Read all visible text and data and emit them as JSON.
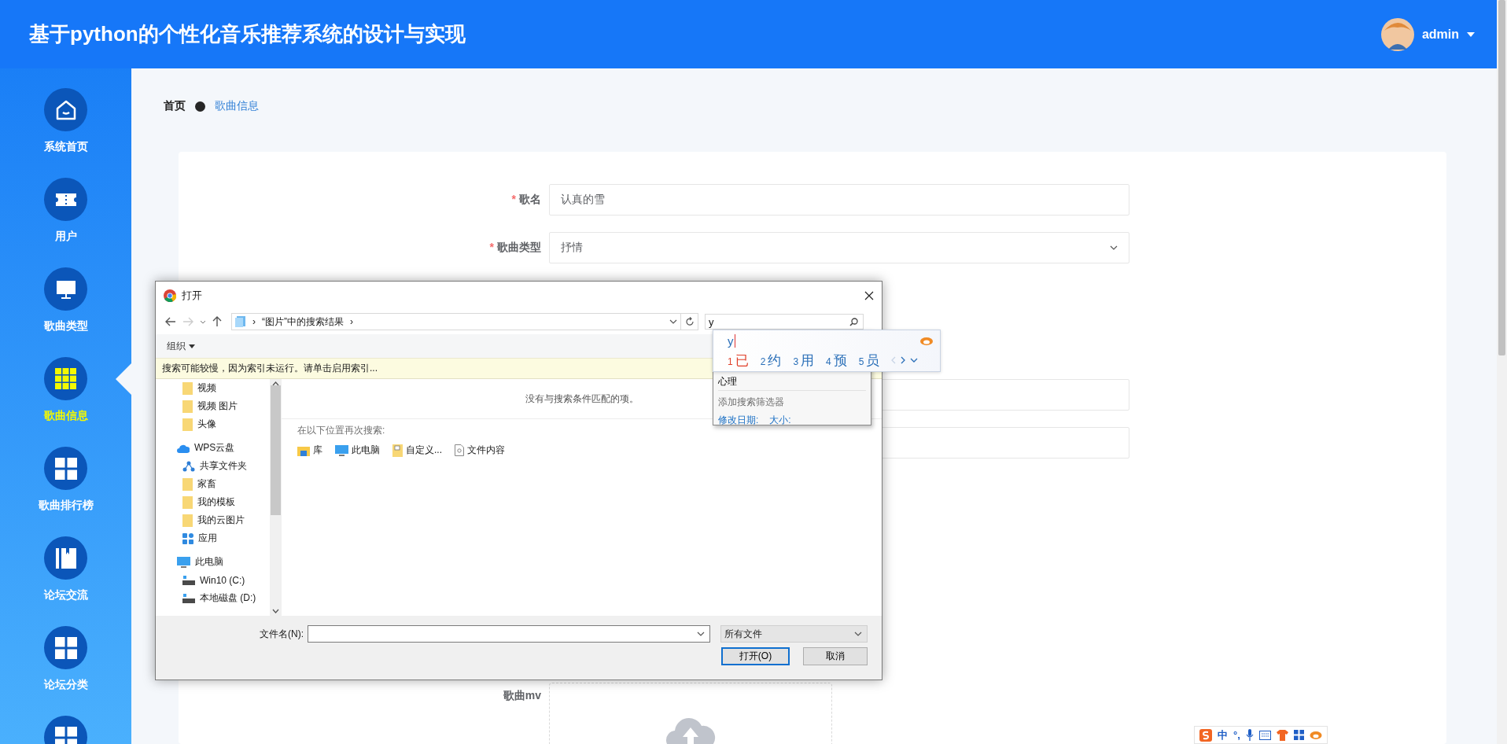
{
  "header": {
    "title": "基于python的个性化音乐推荐系统的设计与实现",
    "user": {
      "name": "admin"
    }
  },
  "sidebar": {
    "items": [
      {
        "label": "系统首页",
        "kind": "home",
        "selected": false
      },
      {
        "label": "用户",
        "kind": "ticket",
        "selected": false
      },
      {
        "label": "歌曲类型",
        "kind": "monitor",
        "selected": false
      },
      {
        "label": "歌曲信息",
        "kind": "grid9",
        "selected": true
      },
      {
        "label": "歌曲排行榜",
        "kind": "grid4",
        "selected": false
      },
      {
        "label": "论坛交流",
        "kind": "book",
        "selected": false
      },
      {
        "label": "论坛分类",
        "kind": "grid4",
        "selected": false
      },
      {
        "kind": "grid4",
        "selected": false
      }
    ]
  },
  "breadcrumb": [
    "首页",
    "歌曲信息"
  ],
  "form": {
    "sections": [
      {
        "fields": [
          {
            "label": "歌名",
            "required_mark": "*",
            "kind": "input",
            "value": "认真的雪"
          },
          {
            "label": "歌曲类型",
            "required_mark": "*",
            "kind": "select",
            "value": "抒情"
          }
        ]
      },
      {
        "fields": [
          {
            "kind": "input"
          },
          {
            "kind": "input"
          }
        ]
      }
    ],
    "upload": {
      "label": "歌曲mv"
    }
  },
  "dialog": {
    "title": "打开",
    "address": [
      "›",
      "“图片”中的搜索结果",
      "›"
    ],
    "search": {
      "value": "y"
    },
    "organize": "组织",
    "info_bar": "搜索可能较慢，因为索引未运行。请单击启用索引...",
    "nav_tree": [
      {
        "children": [
          {
            "label": "视频",
            "kind": "folder"
          },
          {
            "label": "视频 图片",
            "kind": "folder"
          },
          {
            "label": "头像",
            "kind": "folder"
          }
        ]
      },
      {
        "label": "WPS云盘",
        "kind": "cloud",
        "children": [
          {
            "label": "共享文件夹",
            "kind": "share"
          },
          {
            "label": "家畜",
            "kind": "folder"
          },
          {
            "label": "我的模板",
            "kind": "folder"
          },
          {
            "label": "我的云图片",
            "kind": "folder"
          },
          {
            "label": "应用",
            "kind": "apps"
          }
        ]
      },
      {
        "label": "此电脑",
        "kind": "computer",
        "children": [
          {
            "label": "Win10 (C:)",
            "kind": "drive"
          },
          {
            "label": "本地磁盘 (D:)",
            "kind": "drive"
          }
        ]
      }
    ],
    "no_results": "没有与搜索条件匹配的项。",
    "search_again": {
      "heading": "在以下位置再次搜索:",
      "locations": [
        {
          "label": "库",
          "kind": "library"
        },
        {
          "label": "此电脑",
          "kind": "computer"
        },
        {
          "label": "自定义...",
          "kind": "custom"
        },
        {
          "label": "文件内容",
          "kind": "document"
        }
      ]
    },
    "filename_label": "文件名(N):",
    "file_type": "所有文件",
    "buttons": [
      {
        "label": "打开(O)",
        "default": true
      },
      {
        "label": "取消",
        "default": false
      }
    ],
    "search_dropdown": {
      "partial_item": "心理",
      "heading": "添加搜索筛选器",
      "filters": [
        "修改日期:",
        "大小:"
      ]
    }
  },
  "ime": {
    "composition": "y",
    "candidates": [
      {
        "number": "1",
        "text": "已",
        "selected": true
      },
      {
        "number": "2",
        "text": "约",
        "selected": false
      },
      {
        "number": "3",
        "text": "用",
        "selected": false
      },
      {
        "number": "4",
        "text": "预",
        "selected": false
      },
      {
        "number": "5",
        "text": "员",
        "selected": false
      }
    ]
  },
  "ime_bar": {
    "mode": "中",
    "punctuation": "°,"
  }
}
